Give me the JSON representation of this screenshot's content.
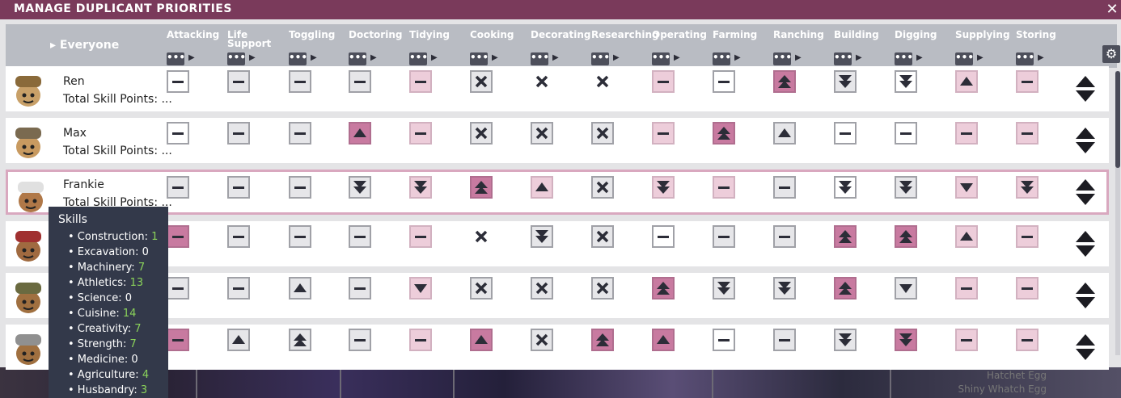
{
  "window": {
    "title": "MANAGE DUPLICANT PRIORITIES",
    "close": "✕"
  },
  "header": {
    "everyone": "▸ Everyone",
    "columns": [
      "Attacking",
      "Life Support",
      "Toggling",
      "Doctoring",
      "Tidying",
      "Cooking",
      "Decorating",
      "Researching",
      "Operating",
      "Farming",
      "Ranching",
      "Building",
      "Digging",
      "Supplying",
      "Storing"
    ],
    "dots": "•••",
    "arrow": "▶",
    "settings_icon": "gear-icon"
  },
  "skills_label": "Total Skill Points: ...",
  "rows": [
    {
      "name": "Ren",
      "selected": false,
      "cells": [
        "w-dash",
        "g-dash",
        "g-dash",
        "g-dash",
        "pl-dash",
        "g-x",
        "n-x",
        "n-x",
        "pl-dash",
        "w-dash",
        "p-uu",
        "g-dd",
        "w-dd",
        "pl-u",
        "pl-dash"
      ]
    },
    {
      "name": "Max",
      "selected": false,
      "cells": [
        "w-dash",
        "g-dash",
        "g-dash",
        "p-u",
        "pl-dash",
        "g-x",
        "g-x",
        "g-x",
        "pl-dash",
        "p-uu",
        "g-u",
        "w-dash",
        "w-dash",
        "pl-dash",
        "pl-dash"
      ]
    },
    {
      "name": "Frankie",
      "selected": true,
      "cells": [
        "g-dash",
        "g-dash",
        "g-dash",
        "g-dd",
        "pl-dd",
        "p-uu",
        "pl-u",
        "g-x",
        "pl-dd",
        "pl-dash",
        "g-dash",
        "w-dd",
        "g-dd",
        "pl-d",
        "pl-dd"
      ]
    },
    {
      "name": "",
      "selected": false,
      "cells": [
        "p-dash",
        "g-dash",
        "g-dash",
        "g-dash",
        "pl-dash",
        "n-x",
        "g-dd",
        "g-x",
        "w-dash",
        "g-dash",
        "g-dash",
        "p-uu",
        "p-uu",
        "pl-u",
        "pl-dash"
      ]
    },
    {
      "name": "",
      "selected": false,
      "cells": [
        "g-dash",
        "g-dash",
        "g-u",
        "g-dash",
        "pl-d",
        "g-x",
        "g-x",
        "g-x",
        "p-uu",
        "g-dd",
        "g-dd",
        "p-uu",
        "g-d",
        "pl-dash",
        "pl-dash"
      ]
    },
    {
      "name": "",
      "selected": false,
      "cells": [
        "p-dash",
        "g-u",
        "g-uu",
        "g-dash",
        "pl-dash",
        "p-u",
        "g-x",
        "p-uu",
        "p-u",
        "w-dash",
        "g-dash",
        "g-dd",
        "p-dd",
        "pl-dash",
        "pl-dash"
      ]
    }
  ],
  "tooltip": {
    "title": "Skills",
    "items": [
      {
        "label": "• Construction: ",
        "value": "1",
        "green": true
      },
      {
        "label": "• Excavation: ",
        "value": "0",
        "green": false
      },
      {
        "label": "• Machinery: ",
        "value": "7",
        "green": true
      },
      {
        "label": "• Athletics: ",
        "value": "13",
        "green": true
      },
      {
        "label": "• Science: ",
        "value": "0",
        "green": false
      },
      {
        "label": "• Cuisine: ",
        "value": "14",
        "green": true
      },
      {
        "label": "• Creativity: ",
        "value": "7",
        "green": true
      },
      {
        "label": "• Strength: ",
        "value": "7",
        "green": true
      },
      {
        "label": "• Medicine: ",
        "value": "0",
        "green": false
      },
      {
        "label": "• Agriculture: ",
        "value": "4",
        "green": true
      },
      {
        "label": "• Husbandry: ",
        "value": "3",
        "green": true
      }
    ]
  },
  "background": {
    "labels": [
      "Hatchet Egg",
      "Shiny Whatch Egg"
    ]
  }
}
